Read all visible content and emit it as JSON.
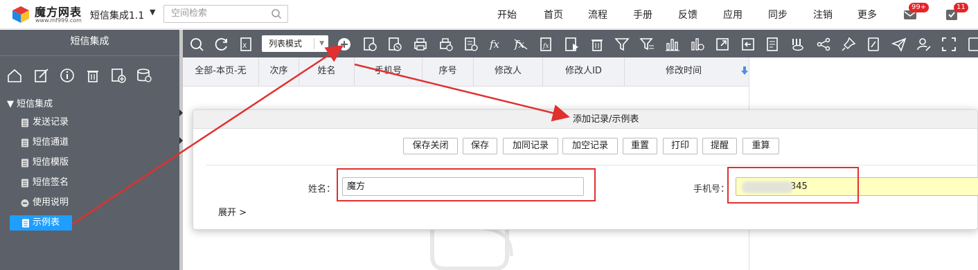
{
  "header": {
    "logo_text": "魔方网表",
    "logo_sub": "www.mf999.com",
    "app_name": "短信集成1.1",
    "search_placeholder": "空间检索",
    "nav": [
      "开始",
      "首页",
      "流程",
      "手册",
      "反馈",
      "应用",
      "同步",
      "注销",
      "更多"
    ],
    "mail_badge": "99+",
    "task_badge": "11"
  },
  "sidebar": {
    "title": "短信集成",
    "icons": [
      "home-icon",
      "edit-icon",
      "info-icon",
      "trash-icon",
      "add-form-icon",
      "database-icon"
    ],
    "tree_root": "短信集成",
    "items": [
      {
        "label": "发送记录",
        "icon": "doc-icon"
      },
      {
        "label": "短信通道",
        "icon": "doc-icon"
      },
      {
        "label": "短信模版",
        "icon": "doc-icon"
      },
      {
        "label": "短信签名",
        "icon": "doc-icon"
      },
      {
        "label": "使用说明",
        "icon": "help-circle-icon"
      },
      {
        "label": "示例表",
        "icon": "doc-icon",
        "active": true
      }
    ]
  },
  "toolbar": {
    "mode_label": "列表模式",
    "icons": [
      "search-icon",
      "refresh-icon",
      "excel-icon",
      "add-icon",
      "view-icon",
      "delete-record-icon",
      "print-icon",
      "print-add-icon",
      "export-icon",
      "fx-icon",
      "fx-off-icon",
      "fx-doc-icon",
      "play-icon",
      "trash-icon",
      "filter-icon",
      "filter-clear-icon",
      "bar-chart-icon",
      "chart-view-icon",
      "export-out-icon",
      "import-in-icon",
      "report-icon",
      "column-icon",
      "share-icon",
      "pin-icon",
      "doc-edit-icon",
      "send-icon",
      "user-edit-icon",
      "fullscreen-icon"
    ]
  },
  "grid": {
    "columns": [
      "全部-本页-无",
      "次序",
      "姓名",
      "手机号",
      "序号",
      "修改人",
      "修改人ID",
      "修改时间"
    ]
  },
  "modal": {
    "title": "添加记录/示例表",
    "buttons": [
      "保存关闭",
      "保存",
      "加同记录",
      "加空记录",
      "重置",
      "打印",
      "提醒",
      "重算"
    ],
    "fields": [
      {
        "label": "姓名：",
        "value": "魔方"
      },
      {
        "label": "手机号：",
        "value": "345"
      }
    ],
    "expand_label": "展开 >"
  },
  "colors": {
    "sidebar_bg": "#5c6068",
    "toolbar_bg": "#5c6068",
    "active_item": "#1e9fff",
    "annotation_red": "#e03030",
    "phone_field_bg": "#ffffc0",
    "badge_red": "#e5242b"
  }
}
